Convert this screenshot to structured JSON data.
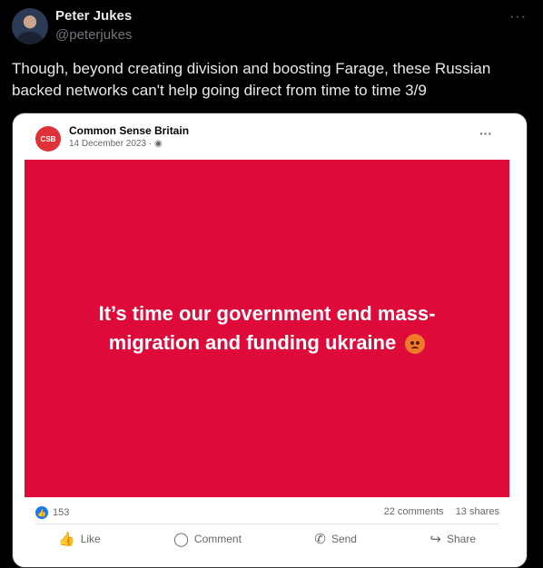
{
  "tweet": {
    "author_name": "Peter Jukes",
    "author_handle": "@peterjukes",
    "more_icon": "···",
    "text": "Though, beyond creating division and boosting Farage, these Russian backed networks can't help going direct from time to time 3/9"
  },
  "card": {
    "logo_text": "CSB",
    "page_name": "Common Sense Britain",
    "post_date": "14 December 2023 · ◉",
    "more_icon": "···",
    "banner_text": "It’s time our government end mass-migration and funding ukraine",
    "banner_color": "#dd0a3a",
    "reactions_count": "153",
    "comments_count": "22 comments",
    "shares_count": "13 shares",
    "actions": [
      {
        "icon": "thumbs-up-icon",
        "glyph": "👍",
        "label": "Like"
      },
      {
        "icon": "comment-icon",
        "glyph": "◯",
        "label": "Comment"
      },
      {
        "icon": "messenger-icon",
        "glyph": "✆",
        "label": "Send"
      },
      {
        "icon": "share-icon",
        "glyph": "↪",
        "label": "Share"
      }
    ]
  }
}
